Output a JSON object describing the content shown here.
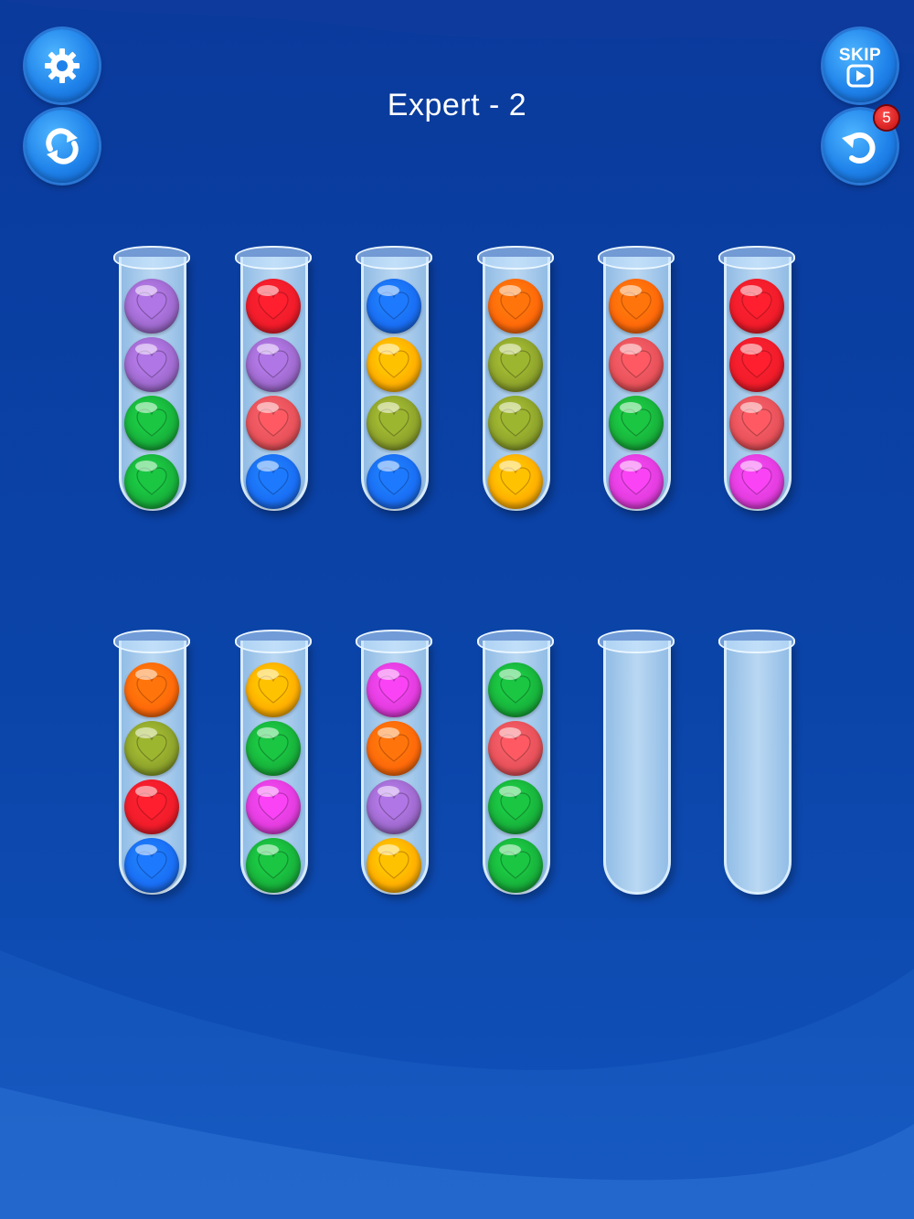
{
  "level": {
    "title": "Expert - 2"
  },
  "buttons": {
    "skip_label": "SKIP",
    "undo_count": "5"
  },
  "colors": {
    "purple": "#a06bd0",
    "red": "#f21c2a",
    "blue": "#1a6ff5",
    "orange": "#ff6a0a",
    "olive": "#8fa52c",
    "yellow": "#ffb000",
    "salmon": "#e9525a",
    "green": "#18b43c",
    "magenta": "#e43de0"
  },
  "tubes": [
    [
      "purple",
      "purple",
      "green",
      "green"
    ],
    [
      "red",
      "purple",
      "salmon",
      "blue"
    ],
    [
      "blue",
      "yellow",
      "olive",
      "blue"
    ],
    [
      "orange",
      "olive",
      "olive",
      "yellow"
    ],
    [
      "orange",
      "salmon",
      "green",
      "magenta"
    ],
    [
      "red",
      "red",
      "salmon",
      "magenta"
    ],
    [
      "orange",
      "olive",
      "red",
      "blue"
    ],
    [
      "yellow",
      "green",
      "magenta",
      "green"
    ],
    [
      "magenta",
      "orange",
      "purple",
      "yellow"
    ],
    [
      "green",
      "salmon",
      "green",
      "green"
    ],
    [],
    []
  ]
}
